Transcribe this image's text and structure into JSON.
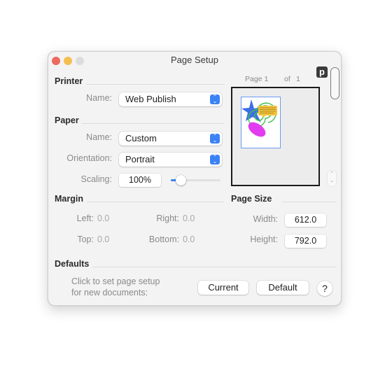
{
  "window": {
    "title": "Page Setup"
  },
  "printer": {
    "section_title": "Printer",
    "name_label": "Name:",
    "name_value": "Web Publish"
  },
  "paper": {
    "section_title": "Paper",
    "name_label": "Name:",
    "name_value": "Custom",
    "orientation_label": "Orientation:",
    "orientation_value": "Portrait",
    "scaling_label": "Scaling:",
    "scaling_value": "100%",
    "scaling_slider_fraction": 0.2
  },
  "preview": {
    "page_label": "Page 1",
    "of_label": "of",
    "page_total": "1",
    "badge": "p",
    "stepper_up": "⌃",
    "stepper_down": "⌄"
  },
  "margin": {
    "section_title": "Margin",
    "left_label": "Left:",
    "left_value": "0.0",
    "right_label": "Right:",
    "right_value": "0.0",
    "top_label": "Top:",
    "top_value": "0.0",
    "bottom_label": "Bottom:",
    "bottom_value": "0.0"
  },
  "page_size": {
    "section_title": "Page Size",
    "width_label": "Width:",
    "width_value": "612.0",
    "height_label": "Height:",
    "height_value": "792.0"
  },
  "defaults": {
    "section_title": "Defaults",
    "description_line1": "Click to set page setup",
    "description_line2": "for new documents:",
    "current_button": "Current",
    "default_button": "Default",
    "help_button": "?"
  },
  "colors": {
    "accent": "#3b82f6",
    "close": "#ed6a5e",
    "minimize": "#f5bf4f",
    "zoom_disabled": "#dcdcdc"
  }
}
